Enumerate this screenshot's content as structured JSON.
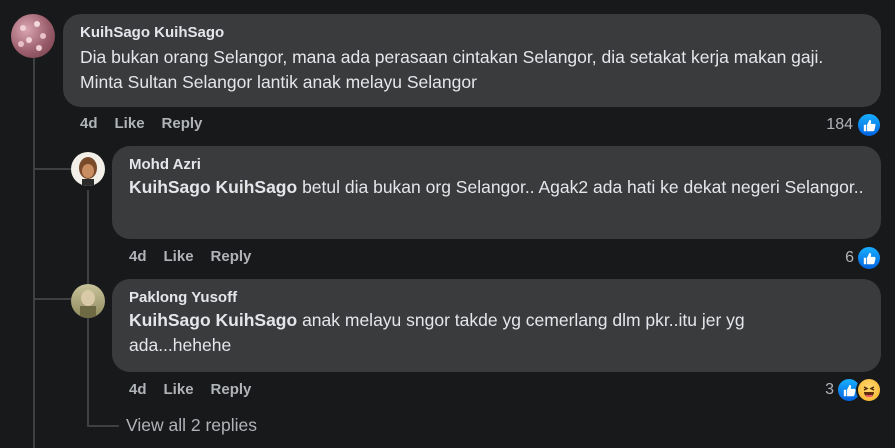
{
  "comments": [
    {
      "author": "KuihSago KuihSago",
      "text": "Dia bukan orang Selangor, mana ada perasaan cintakan Selangor, dia setakat kerja makan gaji. Minta Sultan Selangor lantik anak melayu Selangor",
      "time": "4d",
      "like_label": "Like",
      "reply_label": "Reply",
      "reaction_count": "184"
    },
    {
      "author": "Mohd Azri",
      "mention": "KuihSago KuihSago",
      "text": " betul dia bukan org Selangor.. Agak2 ada hati ke dekat negeri Selangor..",
      "time": "4d",
      "like_label": "Like",
      "reply_label": "Reply",
      "reaction_count": "6"
    },
    {
      "author": "Paklong Yusoff",
      "mention": "KuihSago KuihSago",
      "text": " anak melayu sngor takde yg cemerlang dlm pkr..itu jer yg ada...hehehe",
      "time": "4d",
      "like_label": "Like",
      "reply_label": "Reply",
      "reaction_count": "3"
    }
  ],
  "view_replies": "View all 2 replies",
  "colors": {
    "background": "#18191a",
    "bubble": "#3a3b3c",
    "like_blue": "#1877f2",
    "muted": "#b0b3b8"
  },
  "icons": {
    "like": "like-reaction-icon",
    "haha": "haha-reaction-icon"
  }
}
